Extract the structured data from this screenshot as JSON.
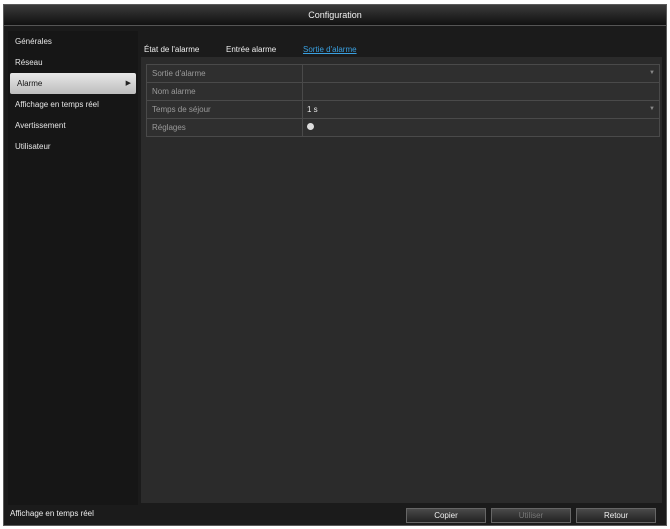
{
  "window": {
    "title": "Configuration"
  },
  "sidebar": {
    "items": [
      {
        "label": "Générales"
      },
      {
        "label": "Réseau"
      },
      {
        "label": "Alarme"
      },
      {
        "label": "Affichage en temps réel"
      },
      {
        "label": "Avertissement"
      },
      {
        "label": "Utilisateur"
      }
    ],
    "active_index": 2
  },
  "tabs": [
    {
      "label": "État de l'alarme"
    },
    {
      "label": "Entrée alarme"
    },
    {
      "label": "Sortie d'alarme"
    }
  ],
  "active_tab": 2,
  "form": {
    "rows": [
      {
        "label": "Sortie d'alarme",
        "value": ""
      },
      {
        "label": "Nom alarme",
        "value": ""
      },
      {
        "label": "Temps de séjour",
        "value": "1 s"
      },
      {
        "label": "Réglages",
        "value": ""
      }
    ]
  },
  "footer": {
    "live_label": "Affichage en temps réel",
    "copy_label": "Copier",
    "apply_label": "Utiliser",
    "back_label": "Retour"
  }
}
